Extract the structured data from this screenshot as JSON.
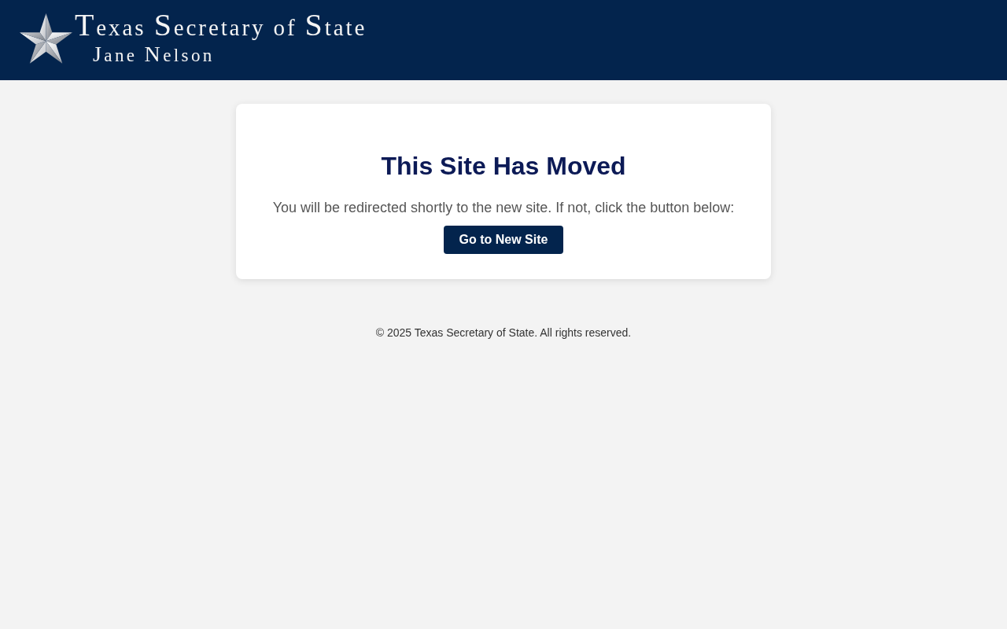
{
  "header": {
    "logo": {
      "title": "Texas Secretary of State",
      "subtitle": "Jane Nelson"
    }
  },
  "notice": {
    "heading": "This Site Has Moved",
    "message": "You will be redirected shortly to the new site. If not, click the button below:",
    "button": "Go to New Site"
  },
  "footer": {
    "copyright": "© 2025 Texas Secretary of State. All rights reserved."
  }
}
